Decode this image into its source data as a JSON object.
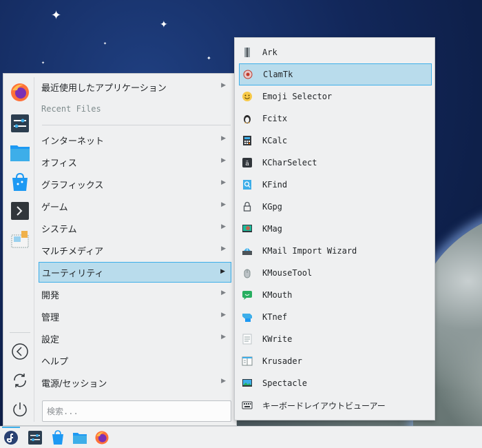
{
  "main_menu": {
    "categories": [
      {
        "label": "最近使用したアプリケーション",
        "has_arrow": true
      },
      {
        "label": "Recent Files",
        "has_arrow": false
      },
      {
        "label": "インターネット",
        "has_arrow": true
      },
      {
        "label": "オフィス",
        "has_arrow": true
      },
      {
        "label": "グラフィックス",
        "has_arrow": true
      },
      {
        "label": "ゲーム",
        "has_arrow": true
      },
      {
        "label": "システム",
        "has_arrow": true
      },
      {
        "label": "マルチメディア",
        "has_arrow": true
      },
      {
        "label": "ユーティリティ",
        "has_arrow": true,
        "selected": true
      },
      {
        "label": "開発",
        "has_arrow": true
      },
      {
        "label": "管理",
        "has_arrow": true
      },
      {
        "label": "設定",
        "has_arrow": true
      },
      {
        "label": "ヘルプ",
        "has_arrow": false
      },
      {
        "label": "電源/セッション",
        "has_arrow": true
      }
    ],
    "arrow_glyph": "▶",
    "search": {
      "placeholder": "検索...",
      "value": ""
    },
    "favorites": [
      "firefox-icon",
      "settings-icon",
      "file-manager-icon",
      "discover-icon",
      "terminal-icon",
      "package-icon"
    ],
    "system_buttons": [
      "lock-screen-icon",
      "switch-user-icon",
      "shutdown-icon"
    ]
  },
  "submenu": {
    "items": [
      {
        "label": "Ark",
        "icon": "archive-icon"
      },
      {
        "label": "ClamTk",
        "icon": "virus-scanner-icon",
        "selected": true
      },
      {
        "label": "Emoji Selector",
        "icon": "emoji-icon"
      },
      {
        "label": "Fcitx",
        "icon": "penguin-icon"
      },
      {
        "label": "KCalc",
        "icon": "calculator-icon"
      },
      {
        "label": "KCharSelect",
        "icon": "charselect-icon"
      },
      {
        "label": "KFind",
        "icon": "find-icon"
      },
      {
        "label": "KGpg",
        "icon": "lock-icon"
      },
      {
        "label": "KMag",
        "icon": "magnifier-icon"
      },
      {
        "label": "KMail Import Wizard",
        "icon": "mail-import-icon"
      },
      {
        "label": "KMouseTool",
        "icon": "mouse-icon"
      },
      {
        "label": "KMouth",
        "icon": "speech-icon"
      },
      {
        "label": "KTnef",
        "icon": "tnef-icon"
      },
      {
        "label": "KWrite",
        "icon": "text-editor-icon"
      },
      {
        "label": "Krusader",
        "icon": "file-manager-twin-icon"
      },
      {
        "label": "Spectacle",
        "icon": "screenshot-icon"
      },
      {
        "label": "キーボードレイアウトビューアー",
        "icon": "keyboard-icon"
      }
    ]
  },
  "taskbar": {
    "items": [
      "fedora-launcher-icon",
      "system-settings-icon",
      "discover-icon",
      "file-manager-icon",
      "firefox-icon"
    ]
  },
  "colors": {
    "accent": "#3daee9",
    "selection_bg": "#b9dcec",
    "panel_bg": "#eff0f1"
  }
}
